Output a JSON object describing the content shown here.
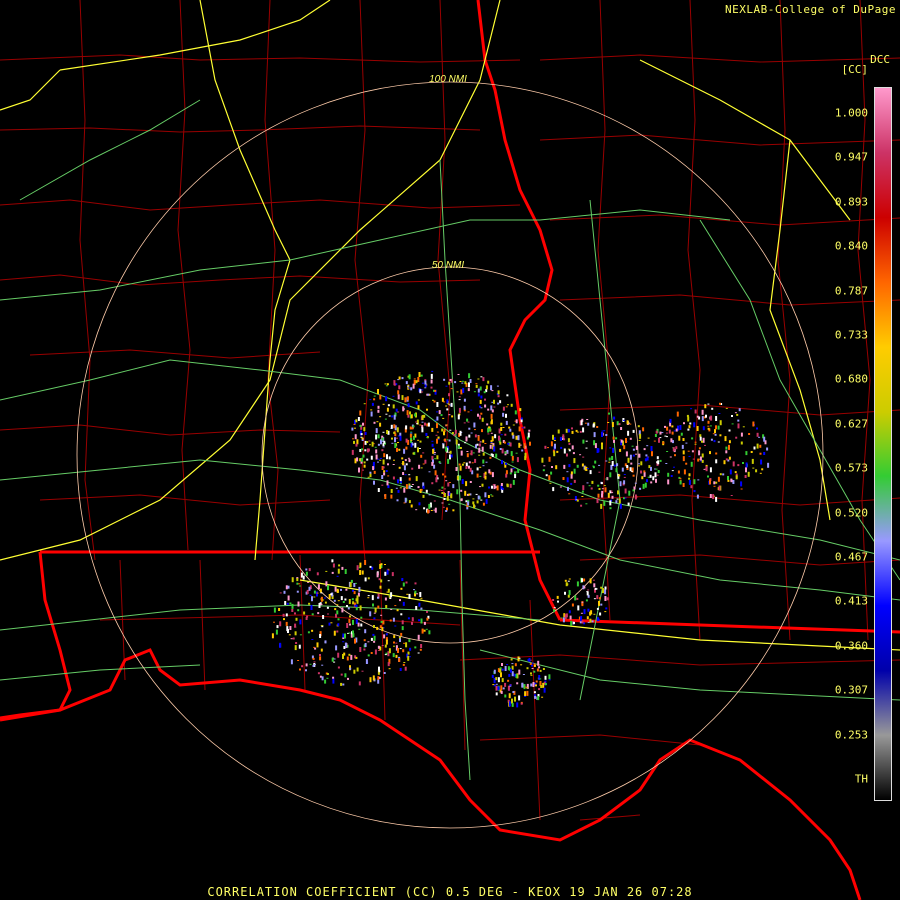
{
  "credit": "NEXLAB-College of DuPage",
  "footer": "CORRELATION COEFFICIENT (CC) 0.5 DEG - KEOX 19 JAN 26 07:28",
  "legend": {
    "product": "DCC",
    "unit": "[CC]",
    "ticks": [
      "1.000",
      "0.947",
      "0.893",
      "0.840",
      "0.787",
      "0.733",
      "0.680",
      "0.627",
      "0.573",
      "0.520",
      "0.467",
      "0.413",
      "0.360",
      "0.307",
      "0.253",
      "TH"
    ]
  },
  "range_rings": [
    {
      "label": "100 NMI"
    },
    {
      "label": "50 NMI"
    }
  ],
  "colors": {
    "background": "#000000",
    "county_lines": "#990000",
    "state_lines": "#ff0000",
    "highways": "#ffff33",
    "roads": "#66cc66",
    "range_rings": "#ffccaa",
    "text": "#ffff66"
  },
  "legend_colors": [
    "#ff99cc",
    "#cc3366",
    "#cc0000",
    "#ff6600",
    "#ffcc00",
    "#cccc00",
    "#33cc33",
    "#9999ff",
    "#0000ff",
    "#0000aa",
    "#999999",
    "#000000"
  ]
}
